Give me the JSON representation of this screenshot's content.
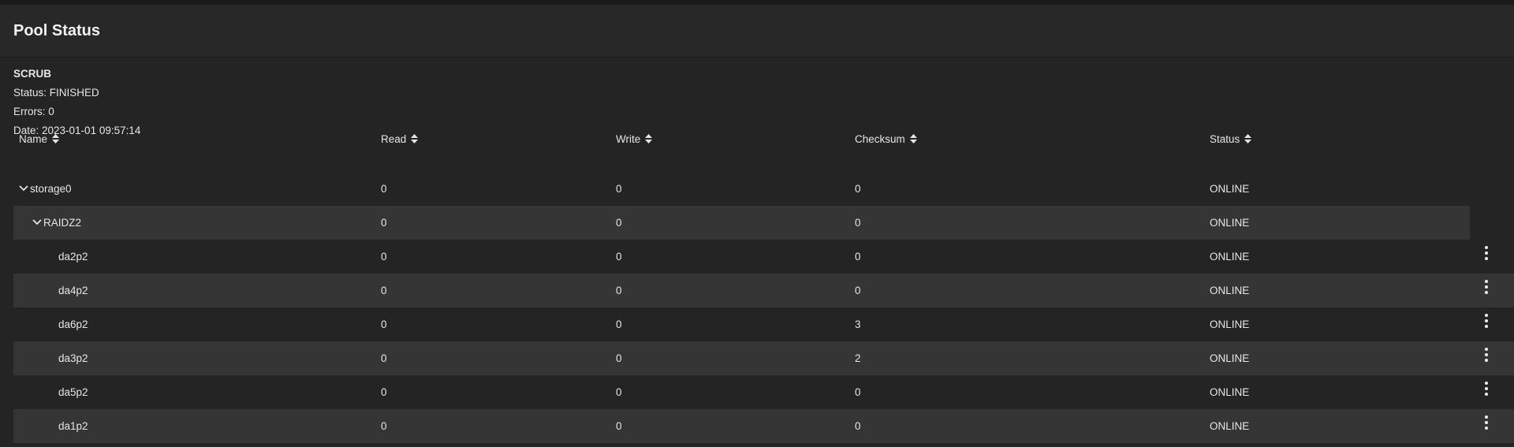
{
  "page": {
    "title": "Pool Status"
  },
  "scrub": {
    "title": "SCRUB",
    "status": "Status: FINISHED",
    "errors": "Errors: 0",
    "date": "Date: 2023-01-01 09:57:14"
  },
  "table": {
    "headers": {
      "name": "Name",
      "read": "Read",
      "write": "Write",
      "checksum": "Checksum",
      "status": "Status"
    },
    "rows": [
      {
        "name": "storage0",
        "read": "0",
        "write": "0",
        "checksum": "0",
        "status": "ONLINE"
      },
      {
        "name": "RAIDZ2",
        "read": "0",
        "write": "0",
        "checksum": "0",
        "status": "ONLINE"
      },
      {
        "name": "da2p2",
        "read": "0",
        "write": "0",
        "checksum": "0",
        "status": "ONLINE"
      },
      {
        "name": "da4p2",
        "read": "0",
        "write": "0",
        "checksum": "0",
        "status": "ONLINE"
      },
      {
        "name": "da6p2",
        "read": "0",
        "write": "0",
        "checksum": "3",
        "status": "ONLINE"
      },
      {
        "name": "da3p2",
        "read": "0",
        "write": "0",
        "checksum": "2",
        "status": "ONLINE"
      },
      {
        "name": "da5p2",
        "read": "0",
        "write": "0",
        "checksum": "0",
        "status": "ONLINE"
      },
      {
        "name": "da1p2",
        "read": "0",
        "write": "0",
        "checksum": "0",
        "status": "ONLINE"
      }
    ]
  },
  "icons": {
    "sort": "sort-icon",
    "expand": "chevron-down-icon",
    "menu": "more-vert-icon"
  },
  "colors": {
    "background": "#1a1a1a",
    "card": "#242424",
    "row_alt": "#353535",
    "text": "#e6e6e6"
  }
}
